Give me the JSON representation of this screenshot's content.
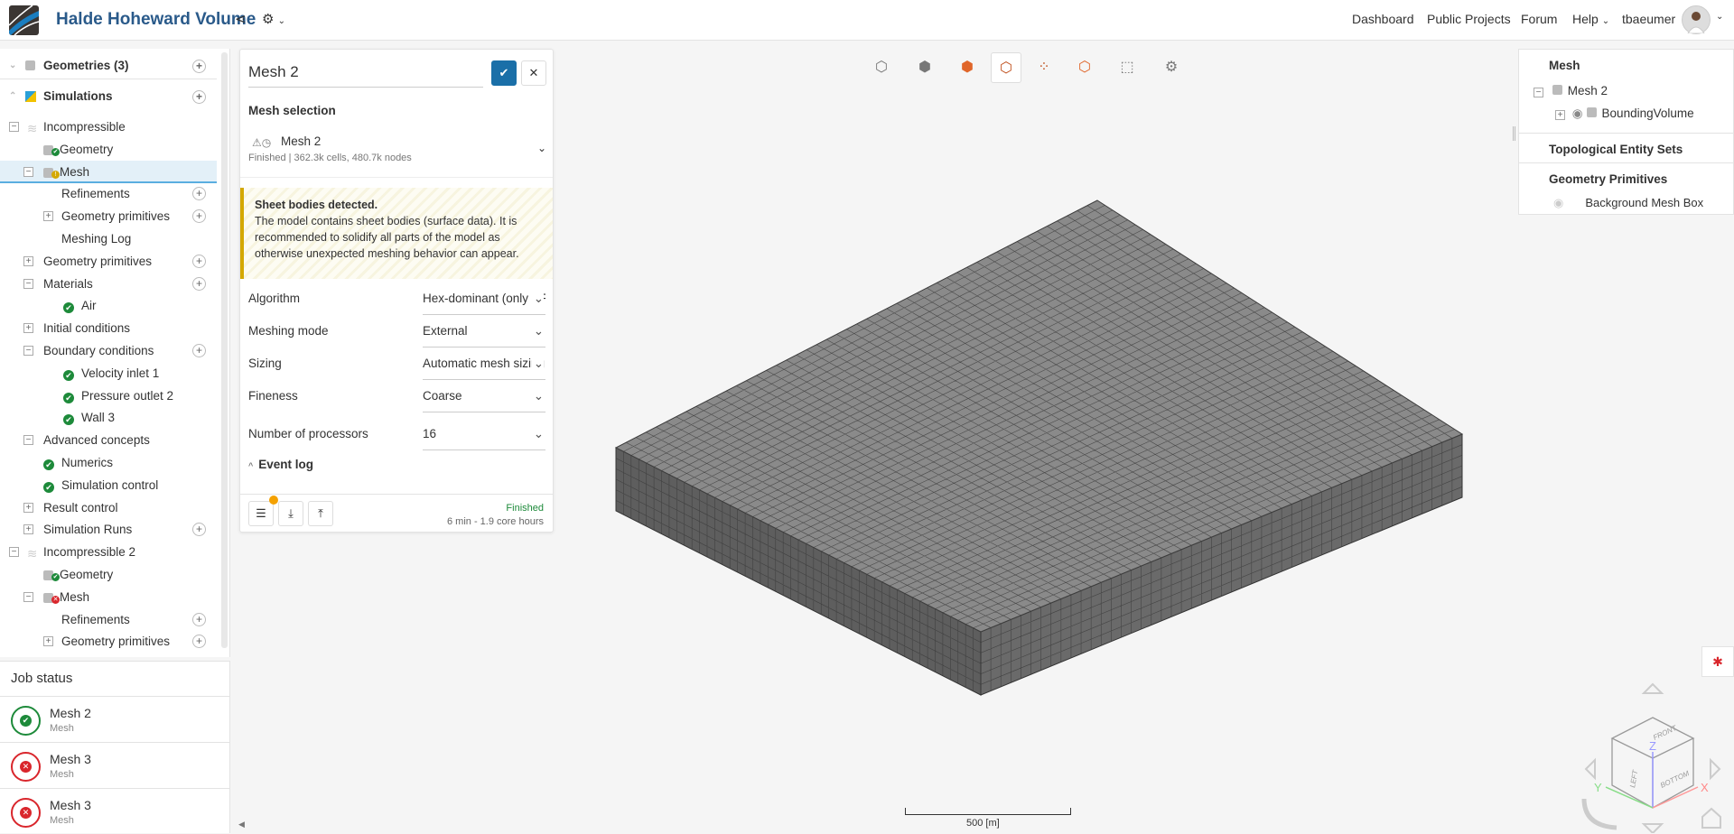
{
  "header": {
    "title": "Halde Hoheward Volume",
    "share_icon": "share-icon",
    "settings_icon": "gear-icon",
    "nav": [
      "Dashboard",
      "Public Projects",
      "Forum",
      "Help"
    ],
    "user": "tbaeumer"
  },
  "tree": {
    "geometries": "Geometries (3)",
    "simulations": "Simulations",
    "items": [
      {
        "label": "Incompressible",
        "lvl": 1,
        "tog": "−",
        "icon": "layers"
      },
      {
        "label": "Geometry",
        "lvl": 2,
        "icon": "geo-ok"
      },
      {
        "label": "Mesh",
        "lvl": 2,
        "tog": "−",
        "icon": "mesh-warn",
        "selected": true
      },
      {
        "label": "Refinements",
        "lvl": 3,
        "plus": true
      },
      {
        "label": "Geometry primitives",
        "lvl": 3,
        "tog": "+",
        "plus": true
      },
      {
        "label": "Meshing Log",
        "lvl": 3
      },
      {
        "label": "Geometry primitives",
        "lvl": 2,
        "tog": "+",
        "plus": true
      },
      {
        "label": "Materials",
        "lvl": 2,
        "tog": "−",
        "plus": true
      },
      {
        "label": "Air",
        "lvl": 3,
        "icon": "check"
      },
      {
        "label": "Initial conditions",
        "lvl": 2,
        "tog": "+"
      },
      {
        "label": "Boundary conditions",
        "lvl": 2,
        "tog": "−",
        "plus": true
      },
      {
        "label": "Velocity inlet 1",
        "lvl": 3,
        "icon": "check"
      },
      {
        "label": "Pressure outlet 2",
        "lvl": 3,
        "icon": "check"
      },
      {
        "label": "Wall 3",
        "lvl": 3,
        "icon": "check"
      },
      {
        "label": "Advanced concepts",
        "lvl": 2,
        "tog": "−"
      },
      {
        "label": "Numerics",
        "lvl": 2.5,
        "icon": "check"
      },
      {
        "label": "Simulation control",
        "lvl": 2.5,
        "icon": "check"
      },
      {
        "label": "Result control",
        "lvl": 2,
        "tog": "+"
      },
      {
        "label": "Simulation Runs",
        "lvl": 2,
        "tog": "+",
        "plus": true
      },
      {
        "label": "Incompressible 2",
        "lvl": 1,
        "tog": "−",
        "icon": "layers"
      },
      {
        "label": "Geometry",
        "lvl": 2,
        "icon": "geo-ok"
      },
      {
        "label": "Mesh",
        "lvl": 2,
        "tog": "−",
        "icon": "mesh-err"
      },
      {
        "label": "Refinements",
        "lvl": 3,
        "plus": true
      },
      {
        "label": "Geometry primitives",
        "lvl": 3,
        "tog": "+",
        "plus": true
      }
    ]
  },
  "jobs": {
    "title": "Job status",
    "items": [
      {
        "name": "Mesh 2",
        "type": "Mesh",
        "status": "success"
      },
      {
        "name": "Mesh 3",
        "type": "Mesh",
        "status": "error"
      },
      {
        "name": "Mesh 3",
        "type": "Mesh",
        "status": "error"
      }
    ]
  },
  "mesh_panel": {
    "name": "Mesh 2",
    "section": "Mesh selection",
    "selected_mesh": "Mesh 2",
    "mesh_info": "Finished | 362.3k cells, 480.7k nodes",
    "warning_title": "Sheet bodies detected.",
    "warning_text": "The model contains sheet bodies (surface data). It is recommended to solidify all parts of the model as otherwise unexpected meshing behavior can appear.",
    "fields": [
      {
        "label": "Algorithm",
        "value": "Hex-dominant (only CFD)"
      },
      {
        "label": "Meshing mode",
        "value": "External"
      },
      {
        "label": "Sizing",
        "value": "Automatic mesh sizing"
      },
      {
        "label": "Fineness",
        "value": "Coarse"
      },
      {
        "label": "Number of processors",
        "value": "16"
      }
    ],
    "event_log": "Event log",
    "status": "Finished",
    "duration": "6 min - 1.9 core hours",
    "status_color": "#1d8a3a"
  },
  "right_panel": {
    "mesh": "Mesh",
    "mesh_item": "Mesh 2",
    "child": "BoundingVolume",
    "topo": "Topological Entity Sets",
    "prims": "Geometry Primitives",
    "prim_item": "Background Mesh Box"
  },
  "viewport": {
    "scale_label": "500 [m]",
    "cube": {
      "front": "FRONT",
      "left": "LEFT",
      "bottom": "BOTTOM",
      "x": "X",
      "y": "Y",
      "z": "Z"
    }
  }
}
